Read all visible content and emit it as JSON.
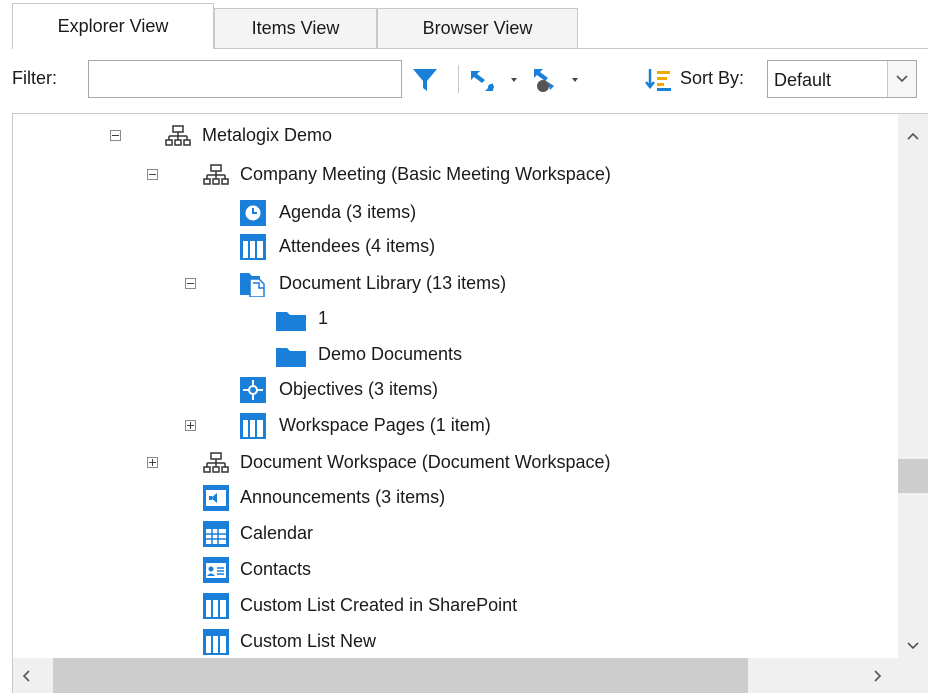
{
  "tabs": [
    {
      "label": "Explorer View",
      "active": true
    },
    {
      "label": "Items View",
      "active": false
    },
    {
      "label": "Browser View",
      "active": false
    }
  ],
  "toolbar": {
    "filter_label": "Filter:",
    "filter_value": "",
    "sort_by_label": "Sort By:",
    "sort_value": "Default",
    "icons": [
      "filter-icon",
      "connect-dropdown-icon",
      "disconnect-dropdown-icon",
      "sort-icon",
      "chevron-down-icon"
    ]
  },
  "tree": [
    {
      "label": "Metalogix Demo",
      "icon": "site-icon",
      "expander": "minus"
    },
    {
      "label": "Company Meeting (Basic Meeting Workspace)",
      "icon": "site-icon",
      "expander": "minus"
    },
    {
      "label": "Agenda (3 items)",
      "icon": "agenda-icon",
      "expander": "none"
    },
    {
      "label": "Attendees (4 items)",
      "icon": "list-icon",
      "expander": "none"
    },
    {
      "label": "Document Library (13 items)",
      "icon": "document-library-icon",
      "expander": "minus"
    },
    {
      "label": "1",
      "icon": "folder-icon",
      "expander": "none"
    },
    {
      "label": "Demo Documents",
      "icon": "folder-icon",
      "expander": "none"
    },
    {
      "label": "Objectives (3 items)",
      "icon": "objectives-icon",
      "expander": "none"
    },
    {
      "label": "Workspace Pages (1 item)",
      "icon": "list-icon",
      "expander": "plus"
    },
    {
      "label": "Document Workspace (Document Workspace)",
      "icon": "site-icon",
      "expander": "plus"
    },
    {
      "label": "Announcements (3 items)",
      "icon": "announcements-icon",
      "expander": "none"
    },
    {
      "label": "Calendar",
      "icon": "calendar-icon",
      "expander": "none"
    },
    {
      "label": "Contacts",
      "icon": "contacts-icon",
      "expander": "none"
    },
    {
      "label": "Custom List Created in SharePoint",
      "icon": "list-icon",
      "expander": "none"
    },
    {
      "label": "Custom List New",
      "icon": "list-icon",
      "expander": "none"
    }
  ],
  "colors": {
    "accent": "#1a7fd8",
    "border": "#c8c8c8",
    "sort_icon": "#f2a900"
  }
}
